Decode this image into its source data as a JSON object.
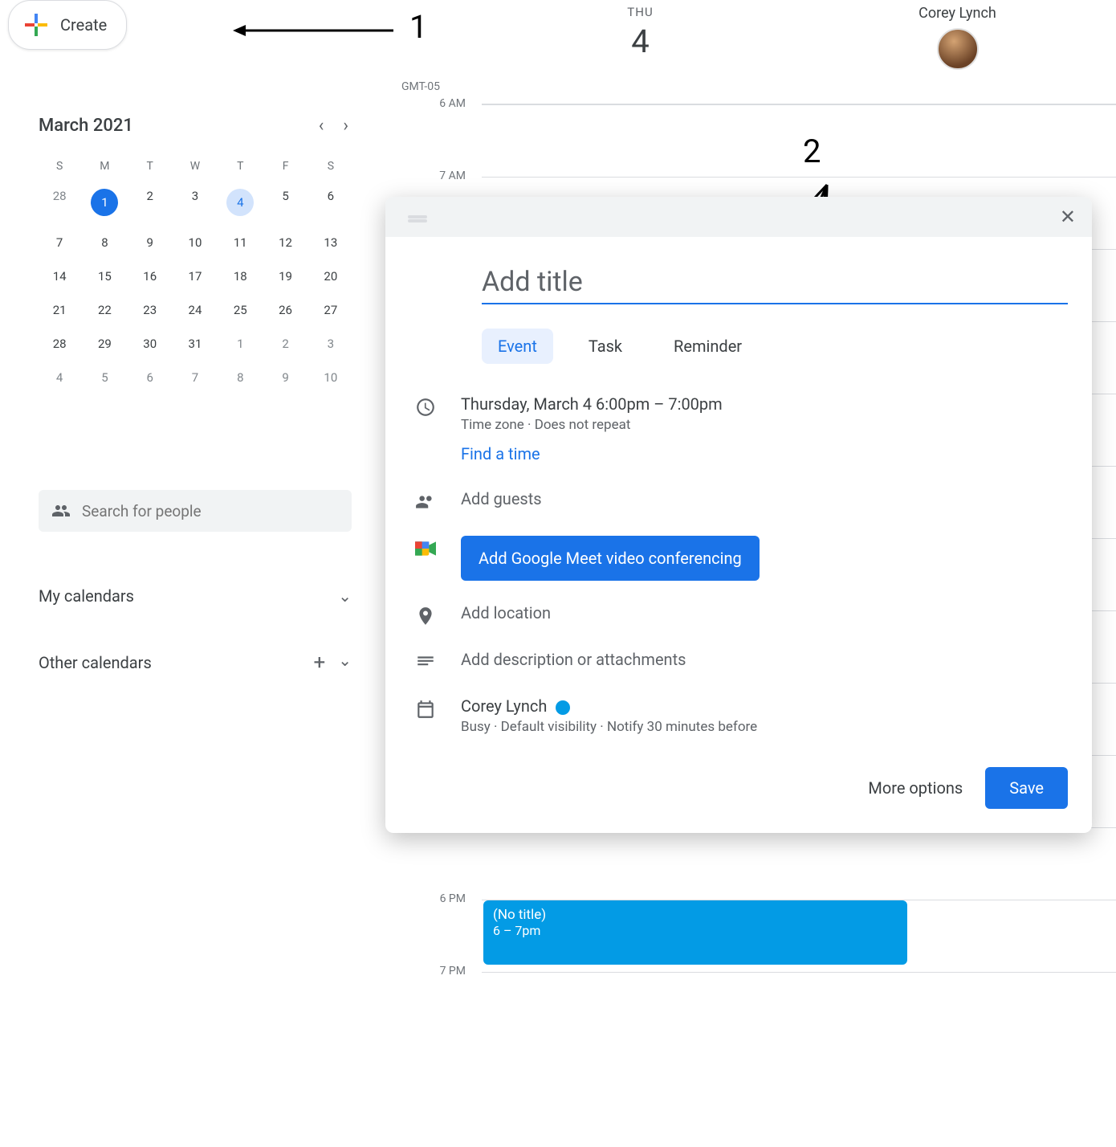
{
  "create_label": "Create",
  "timezone": "GMT-05",
  "minical": {
    "title": "March 2021",
    "dow": [
      "S",
      "M",
      "T",
      "W",
      "T",
      "F",
      "S"
    ],
    "weeks": [
      [
        {
          "d": "28",
          "o": true
        },
        {
          "d": "1",
          "today": true
        },
        {
          "d": "2"
        },
        {
          "d": "3"
        },
        {
          "d": "4",
          "sel": true
        },
        {
          "d": "5"
        },
        {
          "d": "6"
        }
      ],
      [
        {
          "d": "7"
        },
        {
          "d": "8"
        },
        {
          "d": "9"
        },
        {
          "d": "10"
        },
        {
          "d": "11"
        },
        {
          "d": "12"
        },
        {
          "d": "13"
        }
      ],
      [
        {
          "d": "14"
        },
        {
          "d": "15"
        },
        {
          "d": "16"
        },
        {
          "d": "17"
        },
        {
          "d": "18"
        },
        {
          "d": "19"
        },
        {
          "d": "20"
        }
      ],
      [
        {
          "d": "21"
        },
        {
          "d": "22"
        },
        {
          "d": "23"
        },
        {
          "d": "24"
        },
        {
          "d": "25"
        },
        {
          "d": "26"
        },
        {
          "d": "27"
        }
      ],
      [
        {
          "d": "28"
        },
        {
          "d": "29"
        },
        {
          "d": "30"
        },
        {
          "d": "31"
        },
        {
          "d": "1",
          "o": true
        },
        {
          "d": "2",
          "o": true
        },
        {
          "d": "3",
          "o": true
        }
      ],
      [
        {
          "d": "4",
          "o": true
        },
        {
          "d": "5",
          "o": true
        },
        {
          "d": "6",
          "o": true
        },
        {
          "d": "7",
          "o": true
        },
        {
          "d": "8",
          "o": true
        },
        {
          "d": "9",
          "o": true
        },
        {
          "d": "10",
          "o": true
        }
      ]
    ]
  },
  "search_placeholder": "Search for people",
  "sections": {
    "mine": "My calendars",
    "other": "Other calendars"
  },
  "day": {
    "dow": "THU",
    "num": "4",
    "user": "Corey Lynch"
  },
  "hours": [
    "6 AM",
    "7 AM",
    "",
    "",
    "",
    "",
    "",
    "",
    "",
    "",
    "",
    "6 PM",
    "7 PM"
  ],
  "event_block": {
    "title": "(No title)",
    "time": "6 – 7pm"
  },
  "dialog": {
    "title_placeholder": "Add title",
    "tabs": [
      "Event",
      "Task",
      "Reminder"
    ],
    "datetime": "Thursday, March 4   6:00pm  –  7:00pm",
    "tz_repeat": "Time zone · Does not repeat",
    "find_time": "Find a time",
    "guests": "Add guests",
    "meet": "Add Google Meet video conferencing",
    "location": "Add location",
    "description": "Add description or attachments",
    "owner": "Corey Lynch",
    "owner_sub": "Busy · Default visibility · Notify 30 minutes before",
    "more": "More options",
    "save": "Save"
  },
  "annotations": {
    "one": "1",
    "two": "2"
  }
}
